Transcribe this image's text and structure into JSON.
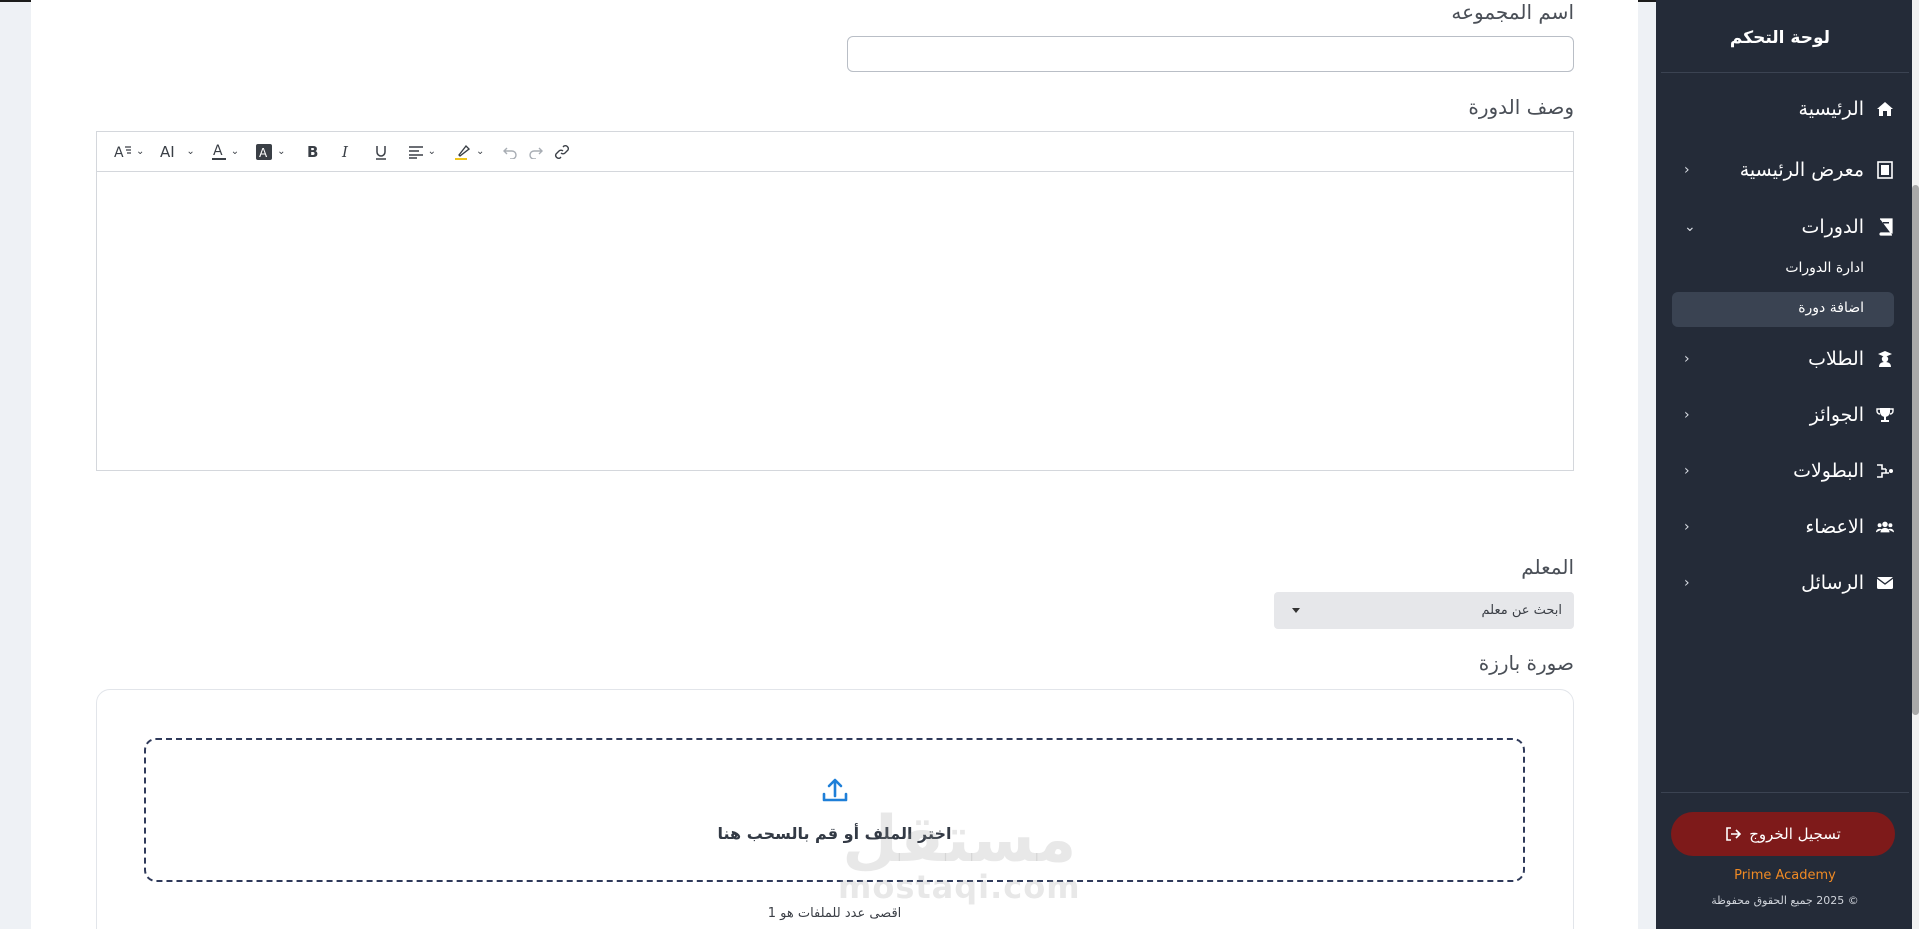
{
  "form": {
    "group_name_label": "اسم المجموعه",
    "group_name_value": "",
    "course_description_label": "وصف الدورة",
    "teacher_label": "المعلم",
    "teacher_placeholder": "ابحث عن معلم",
    "featured_image_label": "صورة بارزة",
    "dropzone_text": "اختر الملف أو قم بالسحب هنا",
    "max_files_text": "اقصى عدد للملفات هو 1"
  },
  "editor_toolbar": {
    "items": [
      "font-size",
      "text-case",
      "text-color",
      "background-color",
      "bold",
      "italic",
      "underline",
      "align",
      "highlight",
      "undo",
      "redo",
      "link"
    ]
  },
  "watermark": {
    "arabic": "مستقل",
    "latin": "mostaqi.com"
  },
  "sidebar": {
    "title": "لوحة التحكم",
    "items": [
      {
        "label": "الرئيسية",
        "icon": "home-icon"
      },
      {
        "label": "معرض الرئيسية",
        "icon": "gallery-icon"
      },
      {
        "label": "الدورات",
        "icon": "book-icon"
      },
      {
        "label": "الطلاب",
        "icon": "graduate-icon"
      },
      {
        "label": "الجوائز",
        "icon": "trophy-icon"
      },
      {
        "label": "البطولات",
        "icon": "tournament-icon"
      },
      {
        "label": "الاعضاء",
        "icon": "users-icon"
      },
      {
        "label": "الرسائل",
        "icon": "envelope-icon"
      }
    ],
    "courses_sub": {
      "manage": "ادارة الدورات",
      "add": "اضافة دورة"
    },
    "logout_label": "تسجيل الخروج",
    "brand": "Prime Academy",
    "copyright": "© 2025 جميع الحقوق محفوظة"
  },
  "colors": {
    "sidebar_bg": "#242b38",
    "logout_bg": "#7e1a1a",
    "brand_orange": "#f08a24",
    "upload_icon": "#1e7fd8"
  }
}
